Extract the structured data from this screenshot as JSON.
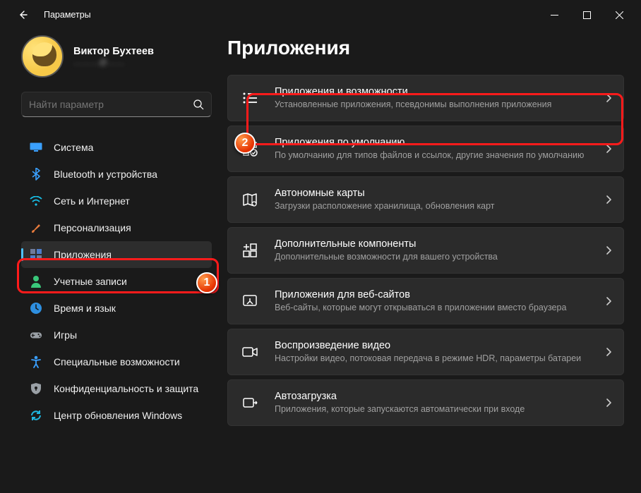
{
  "window": {
    "title": "Параметры"
  },
  "profile": {
    "name": "Виктор Бухтеев",
    "email": "………@……"
  },
  "search": {
    "placeholder": "Найти параметр"
  },
  "sidebar": {
    "items": [
      {
        "label": "Система",
        "icon": "display-icon",
        "color": "#3aa0ff"
      },
      {
        "label": "Bluetooth и устройства",
        "icon": "bluetooth-icon",
        "color": "#3aa0ff"
      },
      {
        "label": "Сеть и Интернет",
        "icon": "wifi-icon",
        "color": "#18c0e8"
      },
      {
        "label": "Персонализация",
        "icon": "brush-icon",
        "color": "#e87b3c"
      },
      {
        "label": "Приложения",
        "icon": "apps-icon",
        "color": "#6f7b9b",
        "selected": true
      },
      {
        "label": "Учетные записи",
        "icon": "person-icon",
        "color": "#39c77a"
      },
      {
        "label": "Время и язык",
        "icon": "clock-icon",
        "color": "#2e8fe0"
      },
      {
        "label": "Игры",
        "icon": "gamepad-icon",
        "color": "#9aa0a6"
      },
      {
        "label": "Специальные возможности",
        "icon": "accessibility-icon",
        "color": "#3aa0ff"
      },
      {
        "label": "Конфиденциальность и защита",
        "icon": "shield-icon",
        "color": "#9aa0a6"
      },
      {
        "label": "Центр обновления Windows",
        "icon": "update-icon",
        "color": "#1fb6e0"
      }
    ]
  },
  "page": {
    "title": "Приложения"
  },
  "cards": [
    {
      "title": "Приложения и возможности",
      "desc": "Установленные приложения, псевдонимы выполнения приложения",
      "icon": "list-icon",
      "highlight": true
    },
    {
      "title": "Приложения по умолчанию",
      "desc": "По умолчанию для типов файлов и ссылок, другие значения по умолчанию",
      "icon": "defaults-icon"
    },
    {
      "title": "Автономные карты",
      "desc": "Загрузки расположение хранилища, обновления карт",
      "icon": "map-icon"
    },
    {
      "title": "Дополнительные компоненты",
      "desc": "Дополнительные возможности для вашего устройства",
      "icon": "add-feature-icon"
    },
    {
      "title": "Приложения для веб-сайтов",
      "desc": "Веб-сайты, которые могут открываться в приложении вместо браузера",
      "icon": "web-app-icon"
    },
    {
      "title": "Воспроизведение видео",
      "desc": "Настройки видео, потоковая передача в режиме HDR, параметры батареи",
      "icon": "video-icon"
    },
    {
      "title": "Автозагрузка",
      "desc": "Приложения, которые запускаются автоматически при входе",
      "icon": "startup-icon"
    }
  ],
  "annotations": {
    "marker1": "1",
    "marker2": "2"
  }
}
